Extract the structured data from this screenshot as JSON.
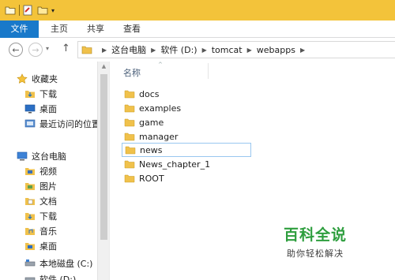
{
  "ribbon": {
    "file": "文件",
    "home": "主页",
    "share": "共享",
    "view": "查看"
  },
  "address": {
    "crumbs": [
      "这台电脑",
      "软件 (D:)",
      "tomcat",
      "webapps"
    ]
  },
  "nav_pane": {
    "favorites_label": "收藏夹",
    "favorites": [
      "下载",
      "桌面",
      "最近访问的位置"
    ],
    "this_pc_label": "这台电脑",
    "this_pc": [
      "视频",
      "图片",
      "文档",
      "下载",
      "音乐",
      "桌面",
      "本地磁盘 (C:)",
      "软件 (D:)"
    ]
  },
  "content": {
    "column_name": "名称",
    "files": [
      "docs",
      "examples",
      "game",
      "manager",
      "news",
      "News_chapter_1",
      "ROOT"
    ],
    "selected": "news"
  },
  "watermark": {
    "main": "百科全说",
    "sub": "助你轻松解决"
  },
  "colors": {
    "titlebar": "#f3c33a",
    "file_tab": "#1979ca",
    "folder": "#f0c14b",
    "watermark": "#2e9e3e",
    "selection_border": "#99c7f0"
  }
}
